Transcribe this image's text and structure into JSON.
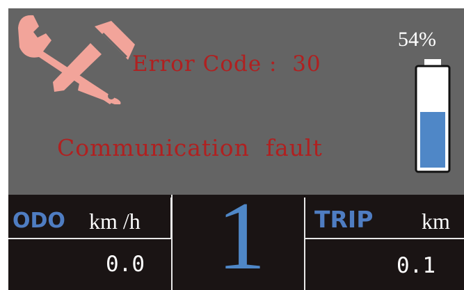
{
  "error": {
    "label": "Error Code :  30",
    "message": "Communication  fault",
    "icon": "wrench-screwdriver-icon"
  },
  "battery": {
    "percent_label": "54%",
    "level": 0.54,
    "fill_color": "#4f87c7"
  },
  "odo": {
    "label": "ODO",
    "unit": "km /h",
    "value": "0.0"
  },
  "gear": {
    "value": "1"
  },
  "trip": {
    "label": "TRIP",
    "unit": "km",
    "value": "0.1"
  },
  "colors": {
    "accent_blue": "#4f7dc2",
    "error_red": "#b02020",
    "icon_pink": "#f2a49a",
    "panel_gray": "#646464"
  }
}
